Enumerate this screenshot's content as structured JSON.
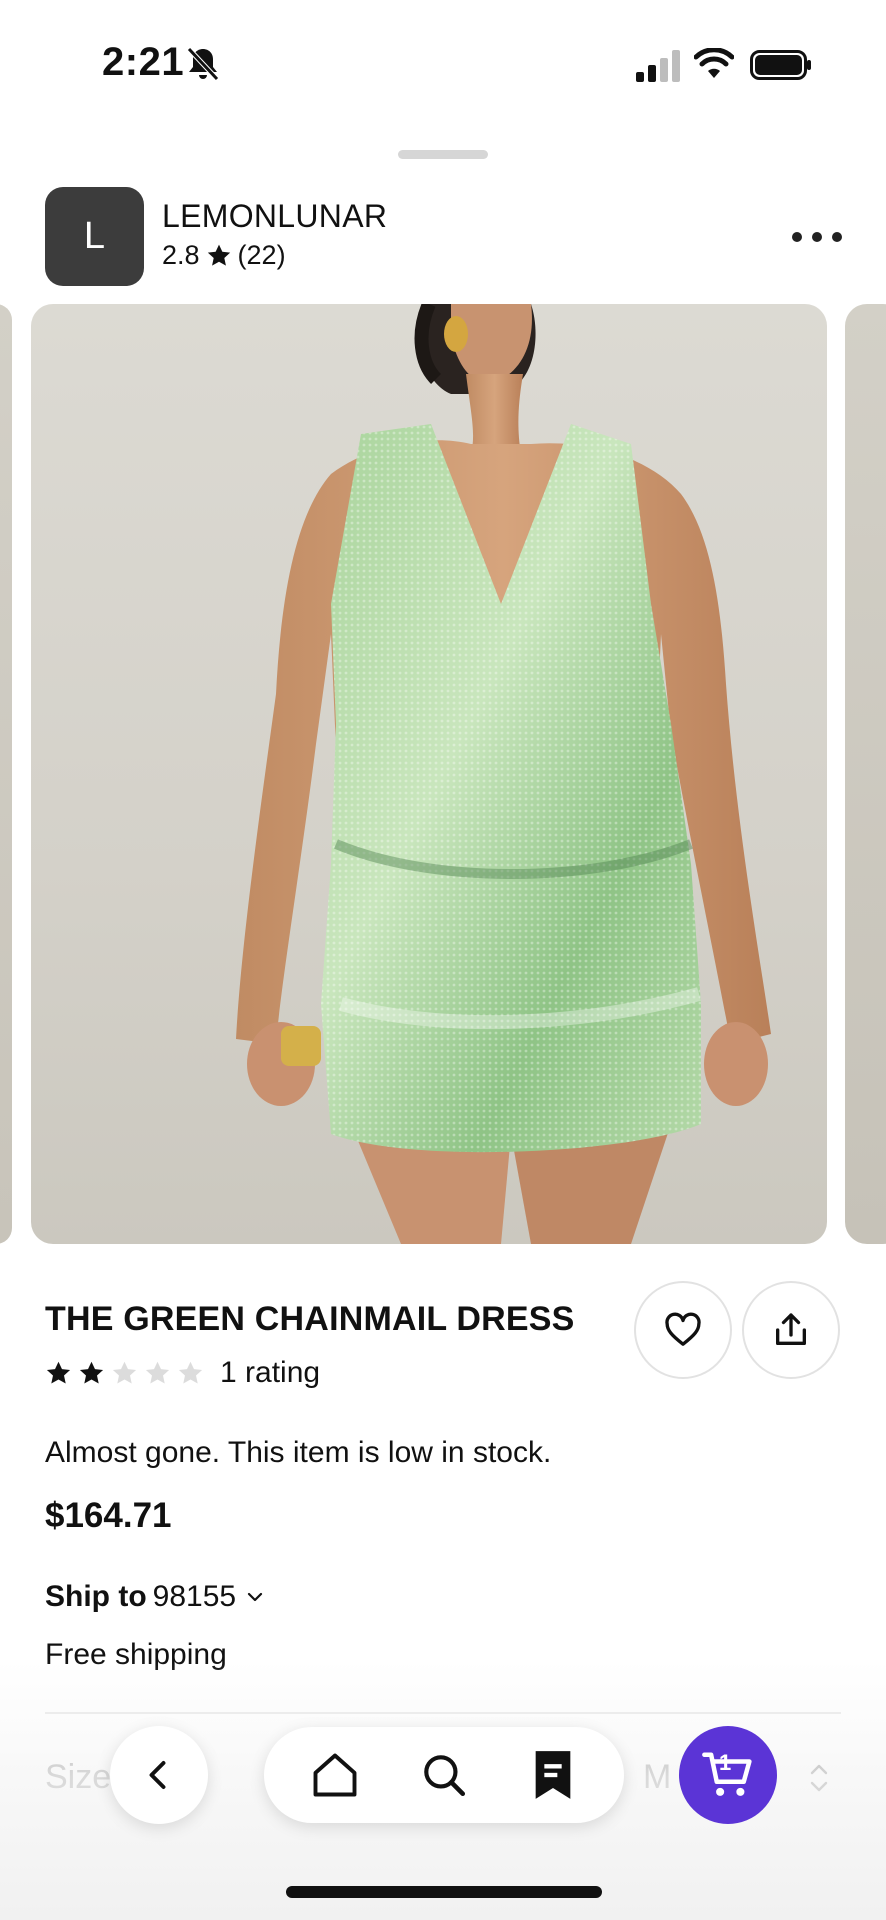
{
  "status_bar": {
    "time": "2:21",
    "icons": [
      "bell-slash-icon",
      "signal-icon",
      "wifi-icon",
      "battery-icon"
    ]
  },
  "shop": {
    "avatar_letter": "L",
    "name": "LEMONLUNAR",
    "rating": "2.8",
    "review_count": "(22)"
  },
  "product": {
    "title": "THE GREEN CHAINMAIL DRESS",
    "stars_filled": 2,
    "stars_total": 5,
    "rating_label": "1 rating",
    "stock_message": "Almost gone. This item is low in stock.",
    "price": "$164.71"
  },
  "shipping": {
    "ship_label": "Ship to",
    "zip": "98155",
    "free_label": "Free shipping"
  },
  "size": {
    "label": "Size",
    "value": "M"
  },
  "nav": {
    "cart_count": "1",
    "icons": [
      "back-icon",
      "home-icon",
      "search-icon",
      "receipt-icon",
      "cart-icon"
    ]
  },
  "colors": {
    "cart_accent": "#5b34d6",
    "avatar_bg": "#3c3c3c",
    "dress_green": "#9fcf95"
  }
}
